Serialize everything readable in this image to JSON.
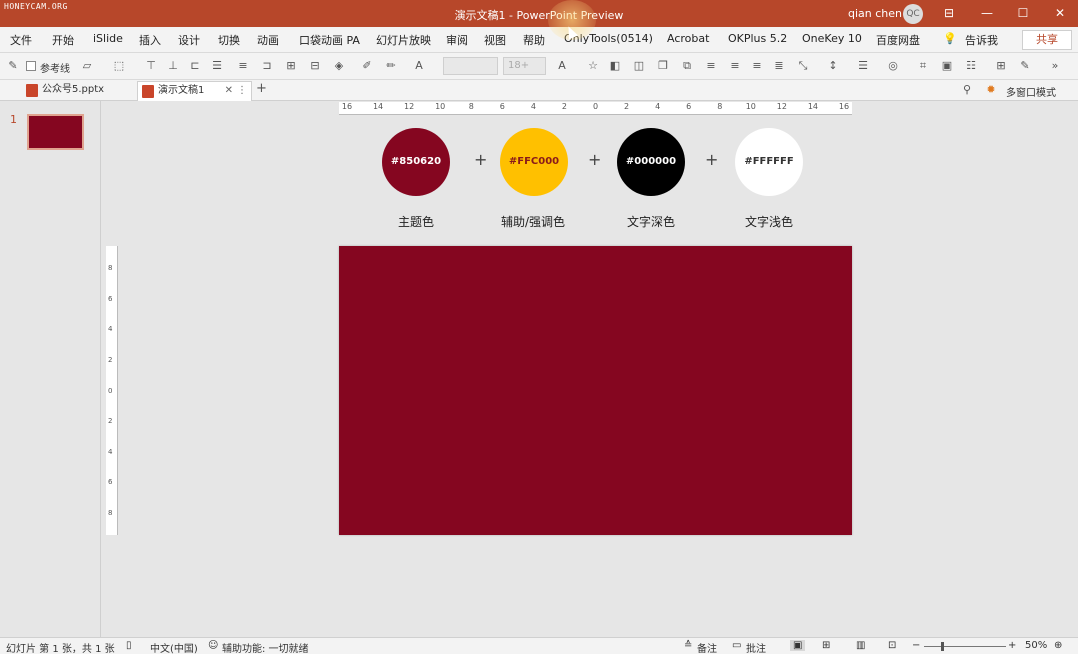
{
  "watermark": "HONEYCAM.ORG",
  "window": {
    "title": "演示文稿1  -  PowerPoint Preview",
    "user": "qian chen",
    "avatar_text": "QC",
    "ribbon_icon": "⊟",
    "minimize": "—",
    "maximize": "☐",
    "close": "✕"
  },
  "menu": {
    "tabs": [
      "文件",
      "开始",
      "iSlide",
      "插入",
      "设计",
      "切换",
      "动画",
      "口袋动画 PA",
      "幻灯片放映",
      "审阅",
      "视图",
      "帮助",
      "OnlyTools(0514)",
      "Acrobat",
      "OKPlus 5.2",
      "OneKey 10",
      "百度网盘",
      "告诉我"
    ],
    "tell_icon": "💡",
    "share": "共享"
  },
  "toolbar": {
    "guides_label": "参考线",
    "font_size_placeholder": "18+"
  },
  "doctabs": {
    "tab1": "公众号5.pptx",
    "tab2": "演示文稿1",
    "close": "✕",
    "more": "⋮",
    "new": "+",
    "multi_window": "多窗口模式"
  },
  "thumbnail": {
    "number": "1"
  },
  "hruler_labels": [
    "16",
    "14",
    "12",
    "10",
    "8",
    "6",
    "4",
    "2",
    "0",
    "2",
    "4",
    "6",
    "8",
    "10",
    "12",
    "14",
    "16"
  ],
  "vruler_labels": [
    "8",
    "6",
    "4",
    "2",
    "0",
    "2",
    "4",
    "6",
    "8"
  ],
  "swatches": [
    {
      "hex": "#850620",
      "text_color": "#ffffff",
      "label": "主题色"
    },
    {
      "hex": "#FFC000",
      "text_color": "#8a1a1a",
      "label": "辅助/强调色"
    },
    {
      "hex": "#000000",
      "text_color": "#ffffff",
      "label": "文字深色"
    },
    {
      "hex": "#FFFFFF",
      "text_color": "#333333",
      "label": "文字浅色"
    }
  ],
  "plus": "+",
  "slide": {
    "background": "#850620"
  },
  "status": {
    "slide_info": "幻灯片 第 1 张，共 1 张",
    "language": "中文(中国)",
    "accessibility": "辅助功能: 一切就绪",
    "notes": "备注",
    "comments": "批注",
    "zoom_minus": "−",
    "zoom_plus": "+",
    "zoom": "50%"
  },
  "colors": {
    "accent": "#b7472a"
  }
}
